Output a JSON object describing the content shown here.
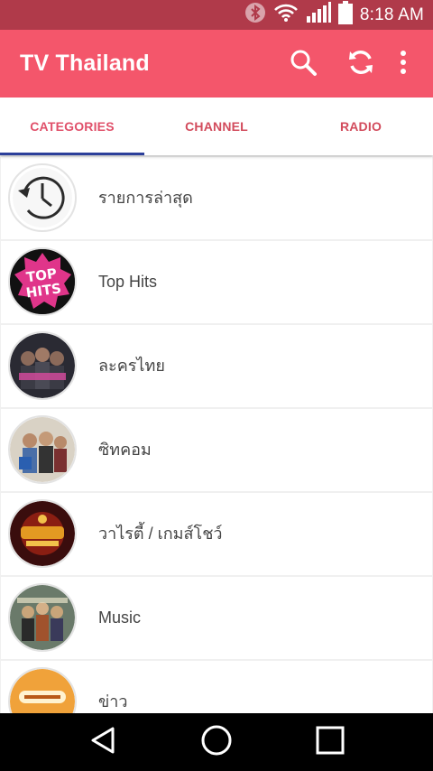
{
  "status_bar": {
    "time": "8:18 AM",
    "icons": [
      "bluetooth-icon",
      "wifi-icon",
      "signal-icon",
      "battery-icon"
    ]
  },
  "app_bar": {
    "title": "TV Thailand",
    "actions": [
      "search-icon",
      "refresh-icon",
      "more-vert-icon"
    ],
    "color": "#f4566b"
  },
  "tabs": [
    {
      "label": "CATEGORIES",
      "selected": true
    },
    {
      "label": "CHANNEL",
      "selected": false
    },
    {
      "label": "RADIO",
      "selected": false
    }
  ],
  "categories": [
    {
      "label": "รายการล่าสุด",
      "icon": "clock-history-icon"
    },
    {
      "label": "Top Hits",
      "icon": "top-hits-thumbnail",
      "image_text": "TOP HITS"
    },
    {
      "label": "ละครไทย",
      "icon": "drama-thumbnail"
    },
    {
      "label": "ซิทคอม",
      "icon": "sitcom-thumbnail"
    },
    {
      "label": "วาไรตี้ / เกมส์โชว์",
      "icon": "variety-thumbnail"
    },
    {
      "label": "Music",
      "icon": "music-thumbnail"
    },
    {
      "label": "ข่าว",
      "icon": "news-thumbnail"
    }
  ],
  "nav_bar": [
    "back-icon",
    "home-icon",
    "recents-icon"
  ]
}
